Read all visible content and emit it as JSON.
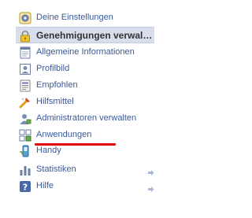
{
  "menu": {
    "items": [
      {
        "label": "Deine Einstellungen",
        "icon": "settings-gear-icon",
        "selected": false
      },
      {
        "label": "Genehmigungen verwalten",
        "icon": "lock-icon",
        "selected": true
      },
      {
        "label": "Allgemeine Informationen",
        "icon": "info-page-icon",
        "selected": false
      },
      {
        "label": "Profilbild",
        "icon": "profile-picture-icon",
        "selected": false
      },
      {
        "label": "Empfohlen",
        "icon": "recommended-page-icon",
        "selected": false
      },
      {
        "label": "Hilfsmittel",
        "icon": "tools-icon",
        "selected": false
      },
      {
        "label": "Administratoren verwalten",
        "icon": "admin-user-icon",
        "selected": false
      },
      {
        "label": "Anwendungen",
        "icon": "apps-puzzle-icon",
        "selected": false
      },
      {
        "label": "Handy",
        "icon": "mobile-phone-icon",
        "selected": false
      },
      {
        "label": "Statistiken",
        "icon": "bar-chart-icon",
        "selected": false,
        "has_arrow": true
      },
      {
        "label": "Hilfe",
        "icon": "help-question-icon",
        "selected": false,
        "has_arrow": true
      }
    ]
  },
  "annotation": {
    "underline_color": "#e00000"
  },
  "colors": {
    "link": "#3b5998",
    "selected_bg": "#d8dfea",
    "selected_text": "#333333"
  }
}
